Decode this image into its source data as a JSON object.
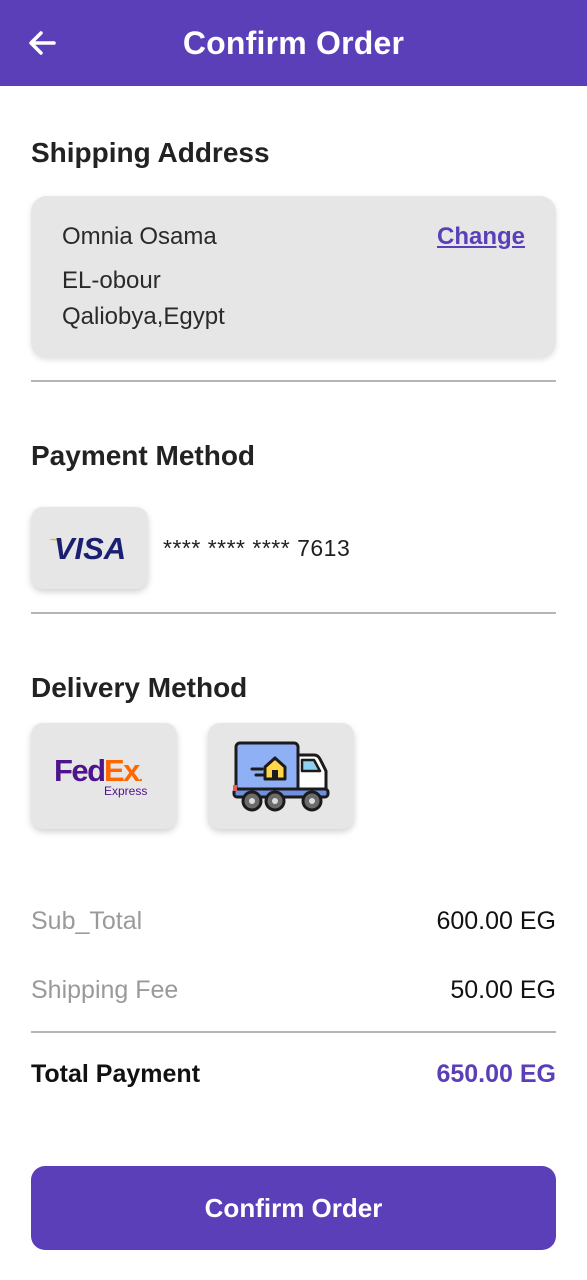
{
  "header": {
    "title": "Confirm Order",
    "back_icon": "arrow-left-icon"
  },
  "shipping": {
    "section_title": "Shipping Address",
    "name": "Omnia Osama",
    "change_label": "Change",
    "address_line1": "EL-obour",
    "address_line2": "Qaliobya,Egypt"
  },
  "payment": {
    "section_title": "Payment Method",
    "card_brand": "VISA",
    "card_number": "**** **** **** 7613"
  },
  "delivery": {
    "section_title": "Delivery Method",
    "options": [
      {
        "name": "FedEx",
        "logo_primary": "Fed",
        "logo_secondary": "Ex",
        "logo_suffix": ".",
        "logo_sub": "Express"
      },
      {
        "name": "home-delivery-truck",
        "icon": "delivery-truck-icon"
      }
    ]
  },
  "summary": {
    "subtotal_label": "Sub_Total",
    "subtotal_value": "600.00 EG",
    "shipping_label": "Shipping Fee",
    "shipping_value": "50.00 EG",
    "total_label": "Total Payment",
    "total_value": "650.00 EG"
  },
  "confirm_button": {
    "label": "Confirm Order"
  },
  "colors": {
    "primary": "#5a3fb8",
    "card_bg": "#e6e6e6",
    "muted_text": "#9a9a9a",
    "fedex_purple": "#4d148c",
    "fedex_orange": "#ff6600",
    "visa_blue": "#1a1f71",
    "visa_gold": "#f7b600"
  }
}
